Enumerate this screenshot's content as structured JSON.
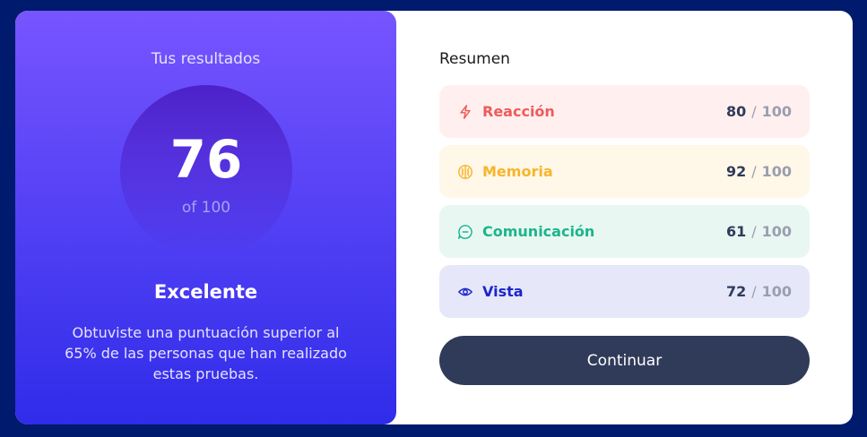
{
  "results": {
    "title": "Tus resultados",
    "score": "76",
    "score_max": "of 100",
    "verdict": "Excelente",
    "description": "Obtuviste una puntuación superior al 65% de las personas que han realizado estas pruebas."
  },
  "summary": {
    "title": "Resumen",
    "items": [
      {
        "label": "Reacción",
        "score": "80",
        "separator": "/",
        "max": "100",
        "icon": "lightning-icon",
        "color": "#F05A5A",
        "bg": "#FFF0EF"
      },
      {
        "label": "Memoria",
        "score": "92",
        "separator": "/",
        "max": "100",
        "icon": "brain-icon",
        "color": "#F7B52B",
        "bg": "#FFF7E8"
      },
      {
        "label": "Comunicación",
        "score": "61",
        "separator": "/",
        "max": "100",
        "icon": "chat-icon",
        "color": "#1BB58A",
        "bg": "#E8F7F2"
      },
      {
        "label": "Vista",
        "score": "72",
        "separator": "/",
        "max": "100",
        "icon": "eye-icon",
        "color": "#1C26C8",
        "bg": "#E6E8FA"
      }
    ]
  },
  "button": {
    "label": "Continuar"
  },
  "colors": {
    "page_bg": "#001A6E",
    "button_bg": "#303B5A"
  }
}
